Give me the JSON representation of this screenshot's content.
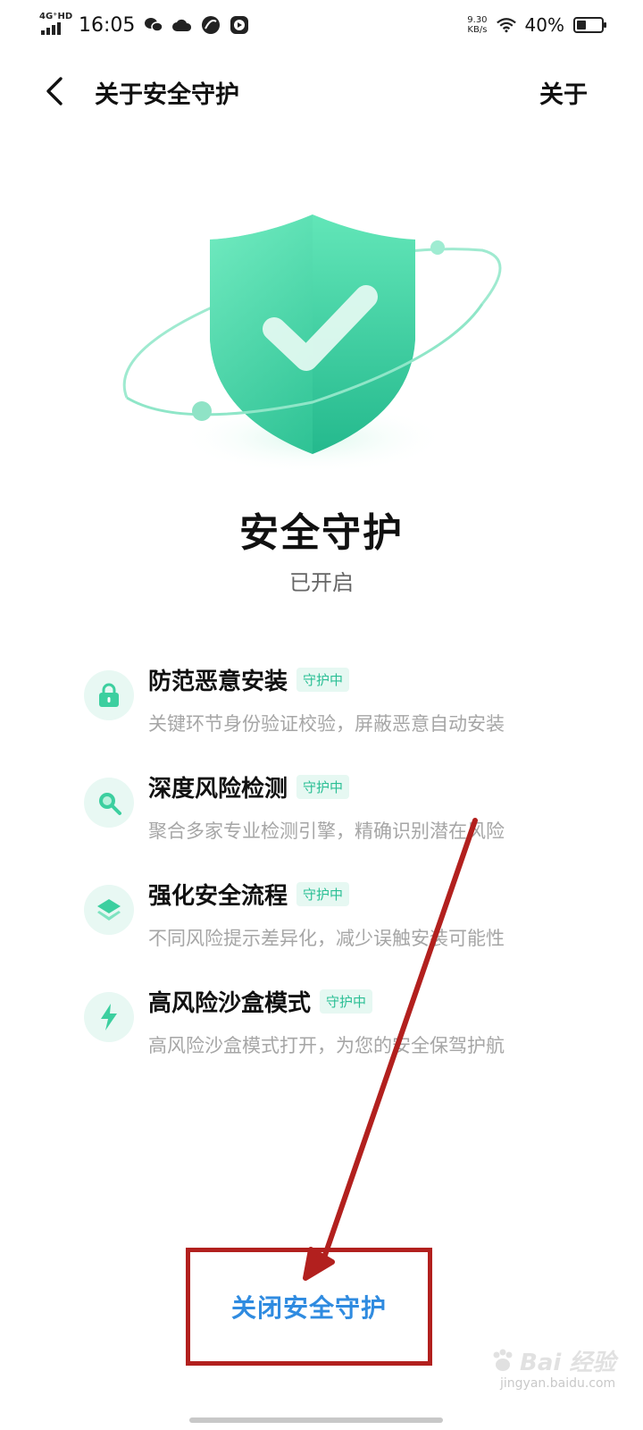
{
  "status_bar": {
    "network": "4G⁺HD",
    "time": "16:05",
    "speed_value": "9.30",
    "speed_unit": "KB/s",
    "battery_percent": "40%",
    "battery_level": 0.4
  },
  "header": {
    "title": "关于安全守护",
    "about": "关于"
  },
  "hero": {
    "title": "安全守护",
    "status": "已开启"
  },
  "features": [
    {
      "title": "防范恶意安装",
      "badge": "守护中",
      "desc": "关键环节身份验证校验，屏蔽恶意自动安装",
      "icon": "lock-icon"
    },
    {
      "title": "深度风险检测",
      "badge": "守护中",
      "desc": "聚合多家专业检测引擎，精确识别潜在风险",
      "icon": "search-icon"
    },
    {
      "title": "强化安全流程",
      "badge": "守护中",
      "desc": "不同风险提示差异化，减少误触安装可能性",
      "icon": "layers-icon"
    },
    {
      "title": "高风险沙盒模式",
      "badge": "守护中",
      "desc": "高风险沙盒模式打开，为您的安全保驾护航",
      "icon": "lightning-icon"
    }
  ],
  "bottom": {
    "close_label": "关闭安全守护"
  },
  "watermark": {
    "main": "Bai  经验",
    "sub": "jingyan.baidu.com"
  },
  "colors": {
    "accent": "#2bbf95",
    "link": "#2f8be0",
    "annotation": "#b2201e"
  }
}
